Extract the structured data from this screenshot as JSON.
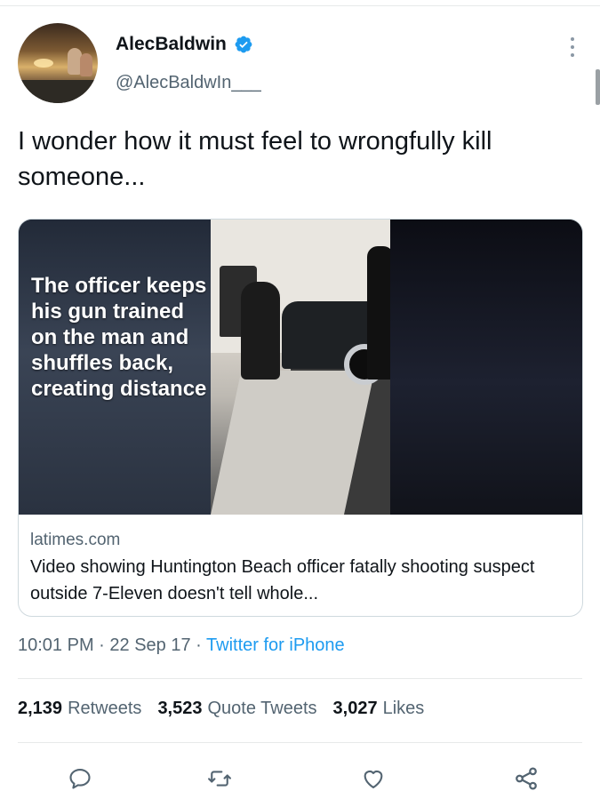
{
  "user": {
    "display_name": "AlecBaldwin",
    "handle": "@AlecBaldwIn___",
    "verified": true
  },
  "tweet": {
    "text": "I wonder how it must feel to wrongfully kill someone..."
  },
  "card": {
    "image_overlay_text": "The officer keeps his gun trained on the man and shuffles back, creating distance",
    "domain": "latimes.com",
    "title": "Video showing Huntington Beach officer fatally shooting suspect outside 7-Eleven doesn't tell whole..."
  },
  "meta": {
    "time": "10:01 PM",
    "sep1": "·",
    "date": "22 Sep 17",
    "sep2": "·",
    "source": "Twitter for iPhone"
  },
  "stats": {
    "retweets_count": "2,139",
    "retweets_label": "Retweets",
    "quotes_count": "3,523",
    "quotes_label": "Quote Tweets",
    "likes_count": "3,027",
    "likes_label": "Likes"
  },
  "actions": {
    "icons": [
      "reply-icon",
      "retweet-icon",
      "like-icon",
      "share-icon"
    ]
  },
  "colors": {
    "accent": "#1d9bf0",
    "text": "#0f1419",
    "secondary": "#536471",
    "divider": "#e7e9ea"
  }
}
